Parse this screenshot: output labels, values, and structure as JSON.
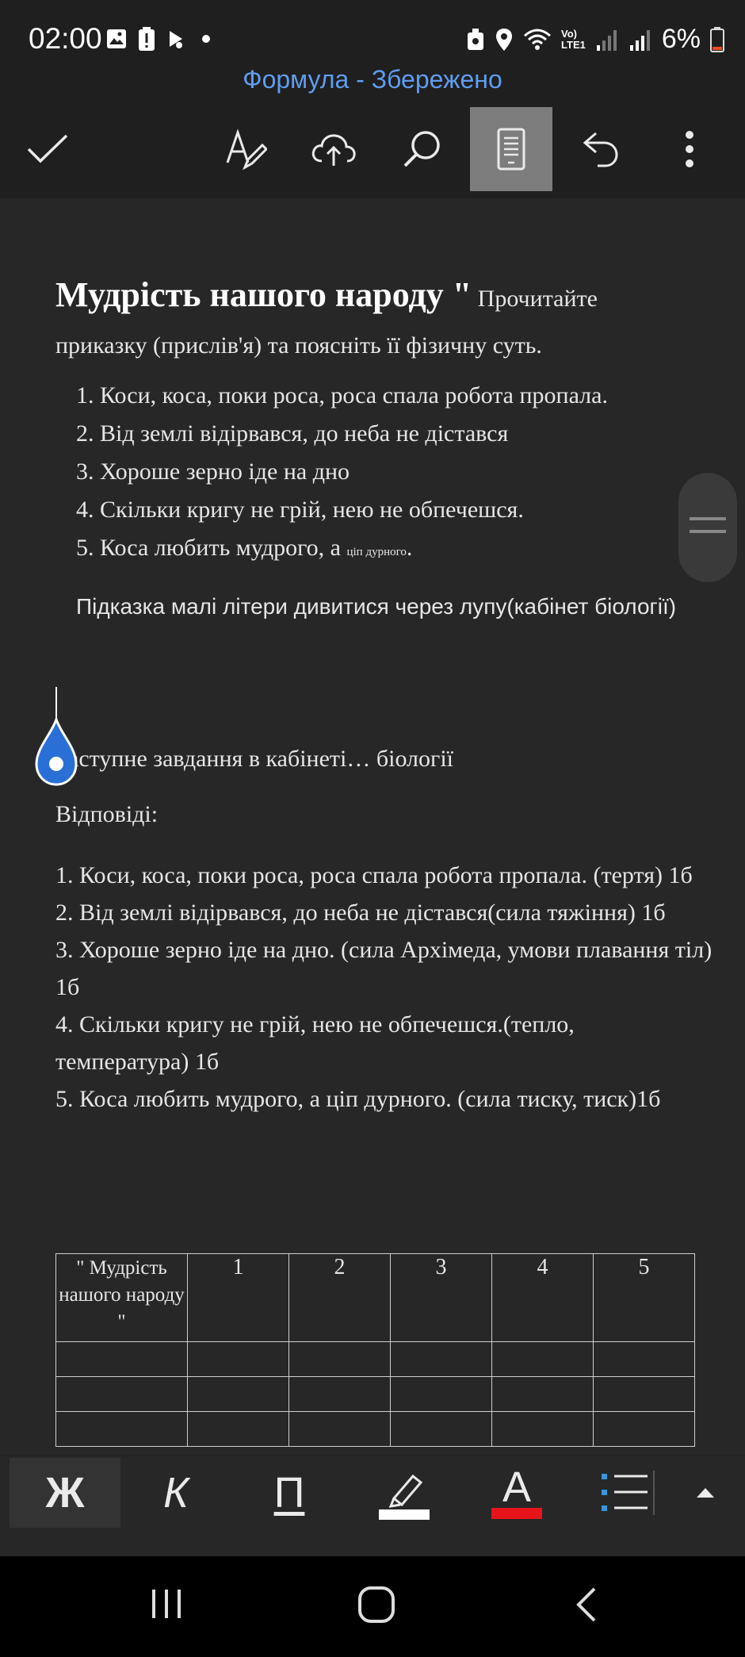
{
  "status_bar": {
    "time": "02:00",
    "battery_percent": "6%",
    "network_label_top": "Vo)",
    "network_label_bottom": "LTE1"
  },
  "document_title": "Формула - Збережено",
  "toolbar": {
    "icons": [
      "check-icon",
      "pen-icon",
      "cloud-upload-icon",
      "search-icon",
      "mobile-view-icon",
      "undo-icon",
      "more-icon"
    ]
  },
  "document": {
    "heading_bold": "Мудрість нашого народу \"",
    "heading_rest": " Прочитайте приказку (прислів'я) та поясніть  її фізичну суть.",
    "proverbs": [
      "Коси, коса, поки роса, роса спала робота пропала.",
      "Від землі відірвався, до неба не дістався",
      "Хороше зерно іде на дно",
      "Скільки кригу не грій, нею не обпечешся."
    ],
    "proverb5_main": "Коса любить мудрого, а ",
    "proverb5_small": "ціп дурного",
    "proverb5_end": ".",
    "hint": "Підказка малі літери дивитися через лупу(кабінет біології)",
    "next_task": "аступне завдання в кабінеті… біології",
    "answers_label": "Відповіді:",
    "answers": [
      "1. Коси, коса, поки роса, роса спала робота пропала. (тертя) 1б",
      "2. Від землі відірвався, до неба не дістався(сила тяжіння) 1б",
      "3. Хороше зерно іде на дно. (сила Архімеда, умови плавання тіл) 1б",
      "4. Скільки кригу не грій, нею не обпечешся.(тепло, температура) 1б",
      "5. Коса любить мудрого, а ціп дурного. (сила тиску, тиск)1б"
    ],
    "table": {
      "header": [
        "\" Мудрість нашого народу \"",
        "1",
        "2",
        "3",
        "4",
        "5"
      ],
      "rows": [
        [
          "",
          "",
          "",
          "",
          "",
          ""
        ],
        [
          "",
          "",
          "",
          "",
          "",
          ""
        ],
        [
          "",
          "",
          "",
          "",
          "",
          ""
        ]
      ]
    }
  },
  "format_bar": {
    "bold_label": "Ж",
    "italic_label": "К",
    "underline_label": "П",
    "font_color_label": "A",
    "highlight_color": "#ffffff",
    "font_color": "#e8141c"
  },
  "colors": {
    "accent_title": "#5f9df0",
    "active_button": "#7d7d7d",
    "drop_handle": "#2a6fd6"
  }
}
